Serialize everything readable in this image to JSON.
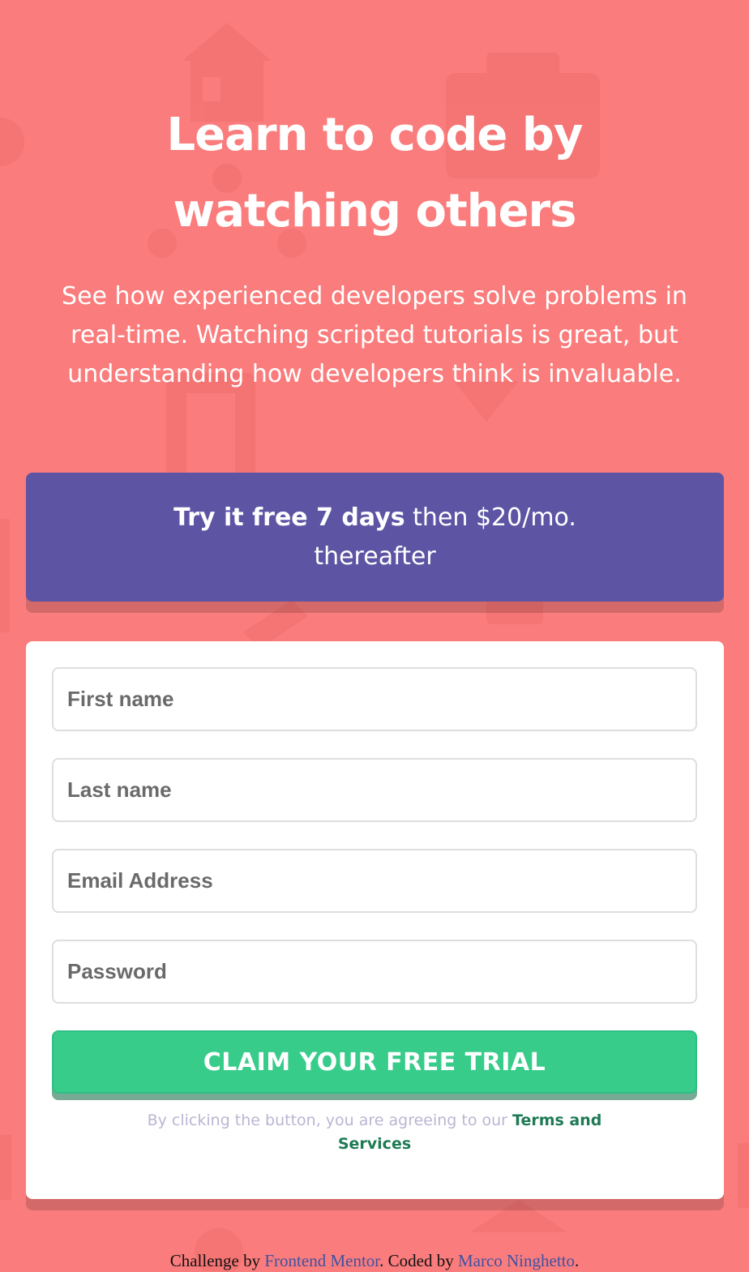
{
  "hero": {
    "title_line1": "Learn to code by",
    "title_line2": "watching others",
    "description_line1": "See how experienced developers solve problems in",
    "description_line2": "real-time. Watching scripted tutorials is great, but",
    "description_line3": "understanding how developers think is invaluable."
  },
  "promo": {
    "bold_text": "Try it free 7 days",
    "rest_text": " then $20/mo.",
    "line2": "thereafter"
  },
  "form": {
    "first_name_placeholder": "First name",
    "last_name_placeholder": "Last name",
    "email_placeholder": "Email Address",
    "password_placeholder": "Password",
    "submit_label": "CLAIM YOUR FREE TRIAL",
    "terms_prefix": "By clicking the button, you are agreeing to our ",
    "terms_link": "Terms and Services"
  },
  "footer": {
    "prefix": "Challenge by ",
    "link1": "Frontend Mentor",
    "middle": ". Coded by ",
    "link2": "Marco Ninghetto",
    "suffix": "."
  },
  "colors": {
    "background": "#fa7c7c",
    "promo": "#5e54a4",
    "accent_green": "#38cc8b",
    "terms_link": "#1f7a56"
  }
}
